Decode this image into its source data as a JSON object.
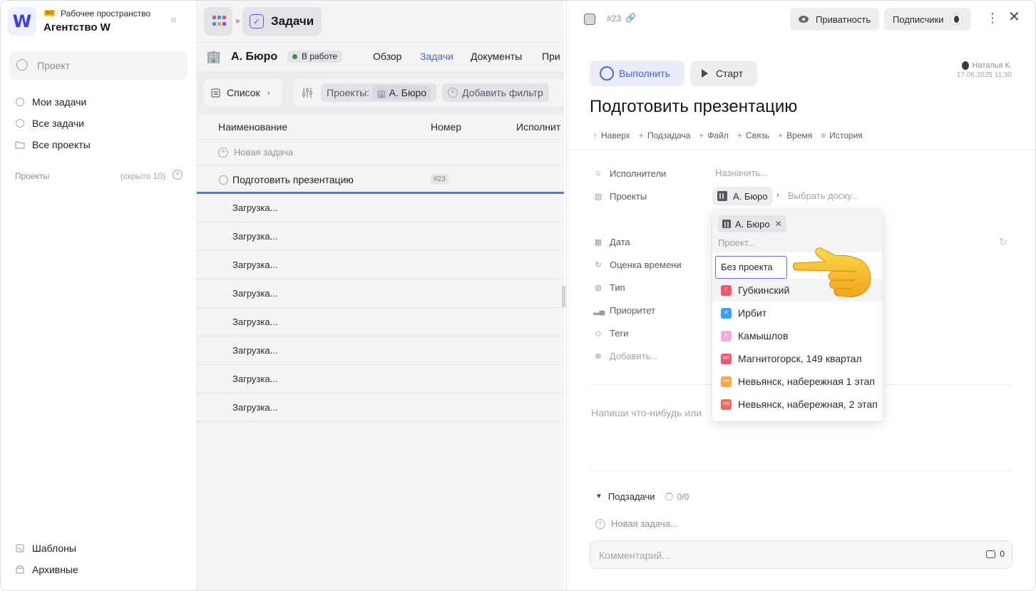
{
  "sidebar": {
    "workspace": {
      "logo": "W",
      "badge": "BIZ",
      "subtitle": "Рабочее пространство",
      "name": "Агентство W"
    },
    "search_placeholder": "Проект",
    "nav": [
      {
        "icon": "check-circle-icon",
        "label": "Мои задачи"
      },
      {
        "icon": "check-circle-icon",
        "label": "Все задачи"
      },
      {
        "icon": "folder-icon",
        "label": "Все проекты"
      }
    ],
    "projects_header": {
      "label": "Проекты",
      "hidden": "(скрыто 10)"
    },
    "bottom": [
      {
        "icon": "templates-icon",
        "label": "Шаблоны"
      },
      {
        "icon": "archive-icon",
        "label": "Архивные"
      }
    ]
  },
  "middle": {
    "tab": {
      "label": "Задачи"
    },
    "project": {
      "title": "А. Бюро",
      "status": "В работе",
      "tabs": [
        "Обзор",
        "Задачи",
        "Документы",
        "При"
      ],
      "active_tab": "Задачи"
    },
    "toolbar": {
      "view": "Список",
      "filter_label": "Проекты:",
      "filter_value": "А. Бюро",
      "add_filter": "Добавить фильтр"
    },
    "columns": [
      "Наименование",
      "Номер",
      "Исполнит"
    ],
    "new_task": "Новая задача",
    "task": {
      "title": "Подготовить презентацию",
      "number": "#23"
    },
    "loading_rows": [
      "Загрузка...",
      "Загрузка...",
      "Загрузка...",
      "Загрузка...",
      "Загрузка...",
      "Загрузка...",
      "Загрузка...",
      "Загрузка..."
    ]
  },
  "panel": {
    "number": "#23",
    "privacy": "Приватность",
    "subscribers": "Подписчики",
    "done": "Выполнить",
    "start": "Старт",
    "author": {
      "name": "Наталья К.",
      "date": "17.06.2025 11:30"
    },
    "title": "Подготовить презентацию",
    "actions": [
      {
        "icon": "↑",
        "label": "Наверх"
      },
      {
        "icon": "+",
        "label": "Подзадача"
      },
      {
        "icon": "+",
        "label": "Файл"
      },
      {
        "icon": "+",
        "label": "Связь"
      },
      {
        "icon": "+",
        "label": "Время"
      },
      {
        "icon": "≡",
        "label": "История"
      }
    ],
    "fields": {
      "assignees": {
        "label": "Исполнители",
        "value": "Назначить..."
      },
      "projects": {
        "label": "Проекты",
        "value": "А. Бюро",
        "board": "Выбрать доску..."
      },
      "date": {
        "label": "Дата"
      },
      "estimate": {
        "label": "Оценка времени"
      },
      "type": {
        "label": "Тип"
      },
      "priority": {
        "label": "Приоритет"
      },
      "tags": {
        "label": "Теги"
      },
      "add": {
        "label": "Добавить..."
      }
    },
    "description_placeholder": "Напиши что-нибудь или",
    "subtasks": {
      "label": "Подзадачи",
      "count": "0/0",
      "new": "Новая задача..."
    },
    "comment": {
      "placeholder": "Комментарий...",
      "count": "0"
    }
  },
  "dropdown": {
    "selected_chip": "А. Бюро",
    "search_placeholder": "Проект...",
    "no_project": "Без проекта",
    "options": [
      {
        "abbr": "Г",
        "label": "Губкинский",
        "color": "#f0566e"
      },
      {
        "abbr": "И",
        "label": "Ирбит",
        "color": "#3d9ef5"
      },
      {
        "abbr": "К",
        "label": "Камышлов",
        "color": "#f7a9dd"
      },
      {
        "abbr": "МП",
        "label": "Магнитогорск, 149 квартал",
        "color": "#f0566e"
      },
      {
        "abbr": "НН",
        "label": "Невьянск, набережная 1 этап",
        "color": "#f5a64a"
      },
      {
        "abbr": "НН",
        "label": "Невьянск, набережная, 2 этап",
        "color": "#ee6a5c"
      }
    ]
  },
  "colors": {
    "accent": "#4a68e0",
    "status_green": "#25a244"
  }
}
